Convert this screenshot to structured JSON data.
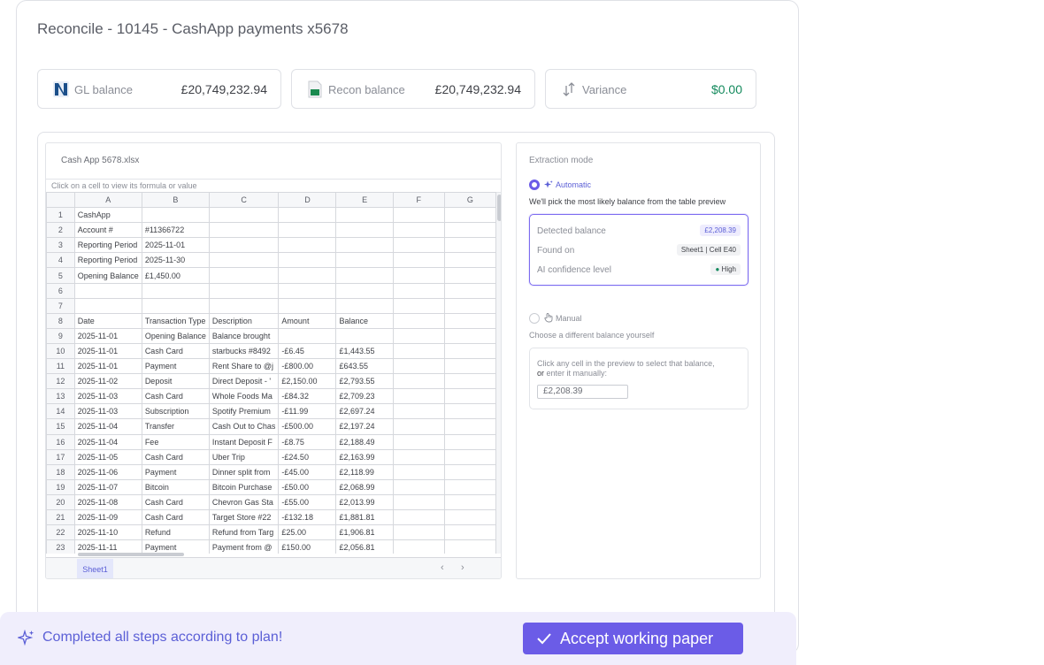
{
  "title": "Reconcile - 10145 - CashApp payments x5678",
  "cards": {
    "gl": {
      "label": "GL balance",
      "value": "£20,749,232.94",
      "icon": "ledger-logo-icon"
    },
    "recon": {
      "label": "Recon balance",
      "value": "£20,749,232.94",
      "icon": "spreadsheet-icon"
    },
    "variance": {
      "label": "Variance",
      "value": "$0.00",
      "icon": "arrows-up-down-icon"
    }
  },
  "sheet": {
    "filename": "Cash App 5678.xlsx",
    "formula_hint": "Click on a cell to view its formula or value",
    "columns": [
      "A",
      "B",
      "C",
      "D",
      "E",
      "F",
      "G"
    ],
    "rows": [
      [
        "1",
        "CashApp",
        "",
        "",
        "",
        "",
        "",
        ""
      ],
      [
        "2",
        "Account #",
        "#11366722",
        "",
        "",
        "",
        "",
        ""
      ],
      [
        "3",
        "Reporting Period",
        "2025-11-01",
        "",
        "",
        "",
        "",
        ""
      ],
      [
        "4",
        "Reporting Period",
        "2025-11-30",
        "",
        "",
        "",
        "",
        ""
      ],
      [
        "5",
        "Opening Balance",
        "£1,450.00",
        "",
        "",
        "",
        "",
        ""
      ],
      [
        "6",
        "",
        "",
        "",
        "",
        "",
        "",
        ""
      ],
      [
        "7",
        "",
        "",
        "",
        "",
        "",
        "",
        ""
      ],
      [
        "8",
        "Date",
        "Transaction Type",
        "Description",
        "Amount",
        "Balance",
        "",
        ""
      ],
      [
        "9",
        "2025-11-01",
        "Opening Balance",
        "Balance brought",
        "",
        "",
        "",
        ""
      ],
      [
        "10",
        "2025-11-01",
        "Cash Card",
        "starbucks #8492",
        "-£6.45",
        "£1,443.55",
        "",
        ""
      ],
      [
        "11",
        "2025-11-01",
        "Payment",
        "Rent Share to @j",
        "-£800.00",
        "£643.55",
        "",
        ""
      ],
      [
        "12",
        "2025-11-02",
        "Deposit",
        "Direct Deposit - '",
        "£2,150.00",
        "£2,793.55",
        "",
        ""
      ],
      [
        "13",
        "2025-11-03",
        "Cash Card",
        "Whole Foods Ma",
        "-£84.32",
        "£2,709.23",
        "",
        ""
      ],
      [
        "14",
        "2025-11-03",
        "Subscription",
        "Spotify Premium",
        "-£11.99",
        "£2,697.24",
        "",
        ""
      ],
      [
        "15",
        "2025-11-04",
        "Transfer",
        "Cash Out to Chas",
        "-£500.00",
        "£2,197.24",
        "",
        ""
      ],
      [
        "16",
        "2025-11-04",
        "Fee",
        "Instant Deposit F",
        "-£8.75",
        "£2,188.49",
        "",
        ""
      ],
      [
        "17",
        "2025-11-05",
        "Cash Card",
        "Uber Trip",
        "-£24.50",
        "£2,163.99",
        "",
        ""
      ],
      [
        "18",
        "2025-11-06",
        "Payment",
        "Dinner split from",
        "-£45.00",
        "£2,118.99",
        "",
        ""
      ],
      [
        "19",
        "2025-11-07",
        "Bitcoin",
        "Bitcoin Purchase",
        "-£50.00",
        "£2,068.99",
        "",
        ""
      ],
      [
        "20",
        "2025-11-08",
        "Cash Card",
        "Chevron Gas Sta",
        "-£55.00",
        "£2,013.99",
        "",
        ""
      ],
      [
        "21",
        "2025-11-09",
        "Cash Card",
        "Target Store #22",
        "-£132.18",
        "£1,881.81",
        "",
        ""
      ],
      [
        "22",
        "2025-11-10",
        "Refund",
        "Refund from Targ",
        "£25.00",
        "£1,906.81",
        "",
        ""
      ],
      [
        "23",
        "2025-11-11",
        "Payment",
        "Payment from @",
        "£150.00",
        "£2,056.81",
        "",
        ""
      ]
    ],
    "tab": "Sheet1",
    "nav_prev": "‹",
    "nav_next": "›"
  },
  "extraction": {
    "heading": "Extraction mode",
    "automatic": {
      "label": "Automatic",
      "description": "We'll pick the most likely balance from the table preview",
      "detected_label": "Detected balance",
      "detected_value": "£2,208.39",
      "found_label": "Found on",
      "found_value": "Sheet1 | Cell E40",
      "confidence_label": "AI confidence level",
      "confidence_value": "High"
    },
    "manual": {
      "label": "Manual",
      "description": "Choose a different balance yourself",
      "help_line1": "Click any cell in the preview to select that balance,",
      "help_or": "or",
      "help_line2": " enter it manually:",
      "input_value": "£2,208.39"
    }
  },
  "banner": {
    "message": "Completed all steps according to plan!",
    "accept_label": "Accept working paper"
  },
  "colors": {
    "accent": "#6b5ce7",
    "positive": "#148a5d",
    "banner_bg": "#f0eefc"
  }
}
